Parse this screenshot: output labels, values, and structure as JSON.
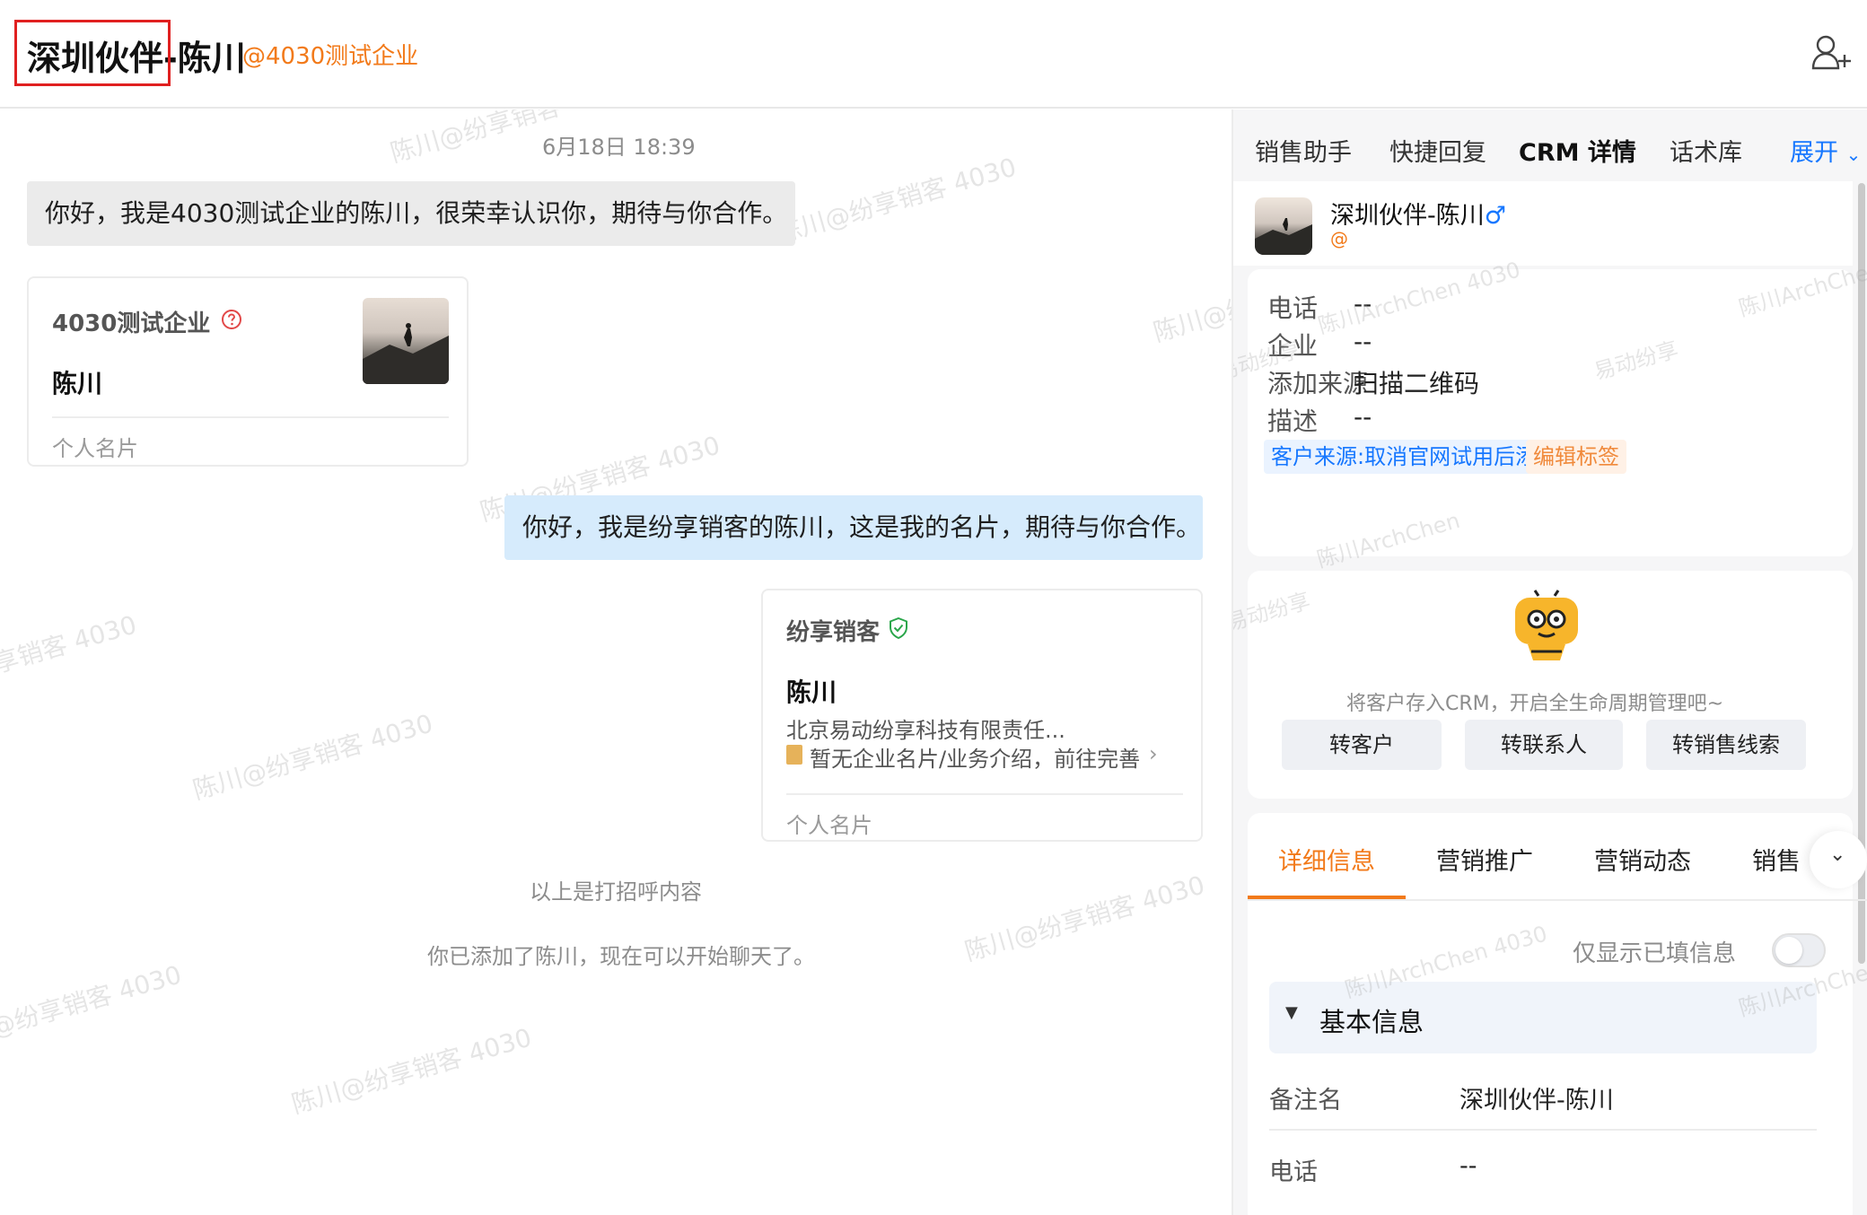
{
  "header": {
    "title": "深圳伙伴-陈川",
    "company_tag": "@4030测试企业"
  },
  "chat": {
    "timestamp": "6月18日 18:39",
    "incoming_message": "你好，我是4030测试企业的陈川，很荣幸认识你，期待与你合作。",
    "incoming_card": {
      "company": "4030测试企业",
      "name": "陈川",
      "footer": "个人名片"
    },
    "outgoing_message": "你好，我是纷享销客的陈川，这是我的名片，期待与你合作。",
    "outgoing_card": {
      "company": "纷享销客",
      "name": "陈川",
      "org": "北京易动纷享科技有限责任...",
      "note": "暂无企业名片/业务介绍，前往完善",
      "footer": "个人名片"
    },
    "system_1": "以上是打招呼内容",
    "system_2": "你已添加了陈川，现在可以开始聊天了。",
    "watermarks": [
      "陈川@纷享销客 4030",
      "陈川@纷享销客 4030",
      "陈川@纷享销客 4030",
      "陈川@纷享销客 4030",
      "陈川@纷享销客 4030",
      "陈川@纷享销客 4030",
      "陈川@纷享销客 4030",
      "陈川@纷享销客 4030",
      "陈川@纷享销客 4030"
    ]
  },
  "panel": {
    "tabs": [
      "销售助手",
      "快捷回复",
      "CRM 详情",
      "话术库"
    ],
    "expand_label": "展开",
    "contact_name": "深圳伙伴-陈川",
    "contact_at": "@",
    "info": [
      {
        "label": "电话",
        "value": "--"
      },
      {
        "label": "企业",
        "value": "--"
      },
      {
        "label": "添加来源",
        "value": "扫描二维码"
      },
      {
        "label": "描述",
        "value": "--"
      }
    ],
    "tag_source": "客户来源:取消官网试用后添加微信",
    "tag_edit": "编辑标签",
    "crm_hint": "将客户存入CRM，开启全生命周期管理吧~",
    "crm_buttons": [
      "转客户",
      "转联系人",
      "转销售线索"
    ],
    "sub_tabs": [
      "详细信息",
      "营销推广",
      "营销动态",
      "销售"
    ],
    "toggle_label": "仅显示已填信息",
    "section_title": "基本信息",
    "fields": [
      {
        "label": "备注名",
        "value": "深圳伙伴-陈川"
      },
      {
        "label": "电话",
        "value": "--"
      }
    ],
    "panel_watermarks": [
      "陈川ArchChen 4030",
      "陈川ArchChen",
      "易动纷享",
      "易动纷享",
      "陈川ArchChen",
      "易动纷享",
      "陈川ArchChen 4030",
      "陈川ArchChen"
    ]
  },
  "colors": {
    "accent_orange": "#f27a1a",
    "accent_blue": "#1677ff",
    "outgoing_bubble": "#d6ebfc",
    "incoming_bubble": "#ebebeb"
  }
}
